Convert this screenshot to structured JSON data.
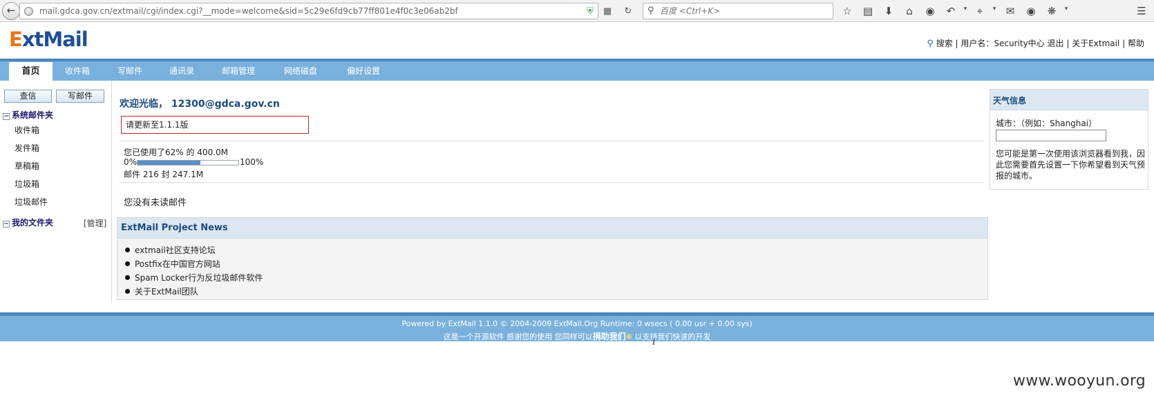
{
  "browser": {
    "url": "mail.gdca.gov.cn/extmail/cgi/index.cgi?__mode=welcome&sid=5c29e6fd9cb77ff801e4f0c3e06ab2bf",
    "search_placeholder": "百度 <Ctrl+K>"
  },
  "header": {
    "logo_e": "E",
    "logo_rest": "xtMail",
    "search_link": "搜索",
    "user_label": "用户名：Security中心",
    "logout": "退出",
    "about": "关于Extmail",
    "help": "帮助"
  },
  "nav": {
    "tabs": [
      {
        "label": "首页",
        "active": true
      },
      {
        "label": "收件箱"
      },
      {
        "label": "写邮件"
      },
      {
        "label": "通讯录"
      },
      {
        "label": "邮箱管理"
      },
      {
        "label": "网络磁盘"
      },
      {
        "label": "偏好设置"
      }
    ]
  },
  "sidebar": {
    "check_button": "查信",
    "compose_button": "写邮件",
    "system_folders_title": "系统邮件夹",
    "system_folders": [
      "收件箱",
      "发件箱",
      "草稿箱",
      "垃圾箱",
      "垃圾邮件"
    ],
    "my_folders_title": "我的文件夹",
    "manage_link": "[管理]"
  },
  "main": {
    "welcome": "欢迎光临， 12300@gdca.gov.cn",
    "update_notice": "请更新至1.1.1版",
    "usage_text": "您已使用了62% 的 400.0M",
    "usage_fraction": 0.62,
    "pct_min": "0%",
    "pct_max": "100%",
    "mail_count": "邮件 216 封 247.1M",
    "no_unread": "您没有未读邮件",
    "news_title": "ExtMail Project News",
    "news_items": [
      "extmail社区支持论坛",
      "Postfix在中国官方网站",
      "Spam Locker行为反垃圾邮件软件",
      "关于ExtMail团队"
    ]
  },
  "weather": {
    "title": "天气信息",
    "city_label": "城市：（例如：Shanghai）",
    "city_value": "",
    "note": "您可能是第一次使用该浏览器看到我，因此您需要首先设置一下你希望看到天气预报的城市。"
  },
  "footer": {
    "line1": "Powered by ExtMail 1.1.0 © 2004-2009 ExtMail.Org Runtime: 0 wsecs ( 0.00 usr + 0.00 sys)",
    "line2_pre": "这是一个开源软件 感谢您的使用 您同样可以",
    "donate": "捐助我们",
    "line2_post": "以支持我们快速的开发"
  },
  "watermark": "www.wooyun.org",
  "colors": {
    "nav_bg": "#7ab1dc",
    "strip": "#4a86bd",
    "title_blue": "#1d4a7e",
    "logo_orange": "#e8761b",
    "logo_blue": "#1d4f99",
    "alert_red": "#c0282d"
  }
}
